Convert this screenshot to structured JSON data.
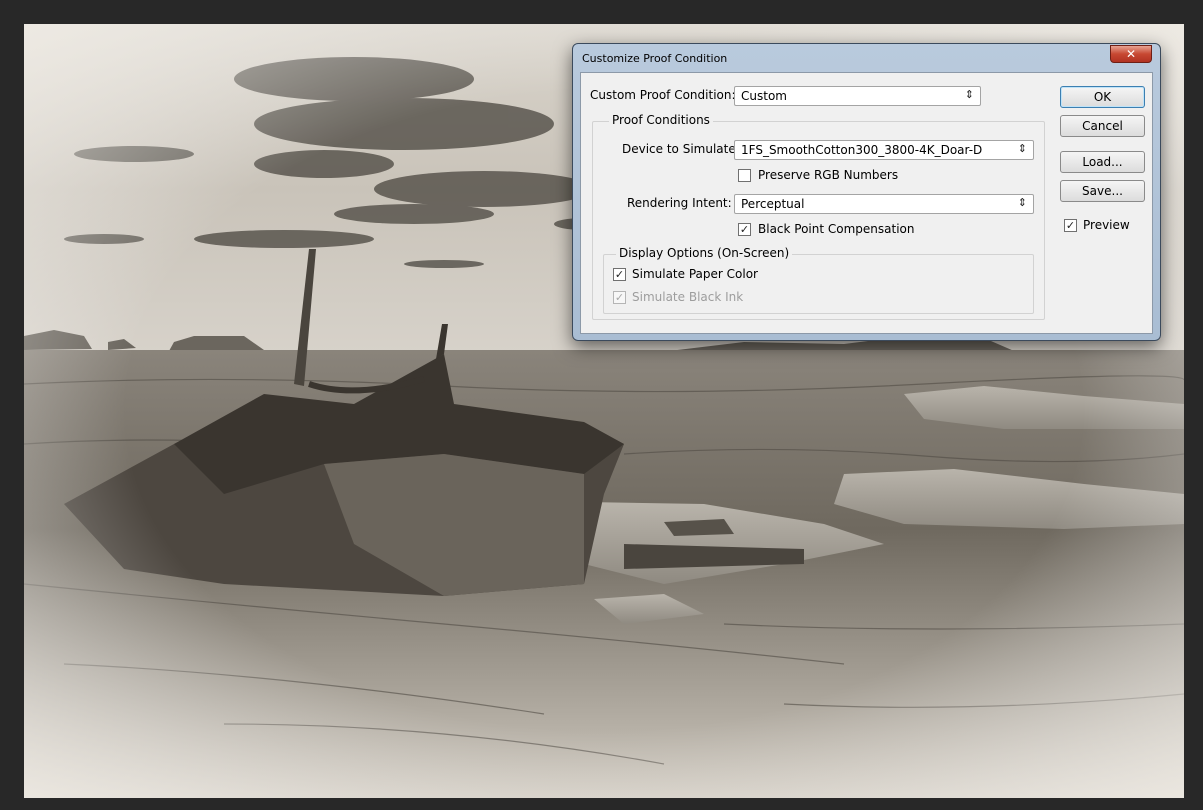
{
  "dialog": {
    "title": "Customize Proof Condition",
    "close_glyph": "✕",
    "custom_condition": {
      "label": "Custom Proof Condition:",
      "value": "Custom"
    },
    "proof_conditions": {
      "legend": "Proof Conditions",
      "device": {
        "label": "Device to Simulate:",
        "value": "1FS_SmoothCotton300_3800-4K_Doar-D"
      },
      "preserve_rgb": {
        "label": "Preserve RGB Numbers",
        "checked": false
      },
      "intent": {
        "label": "Rendering Intent:",
        "value": "Perceptual"
      },
      "black_point": {
        "label": "Black Point Compensation",
        "checked": true
      }
    },
    "display_options": {
      "legend": "Display Options (On-Screen)",
      "paper_color": {
        "label": "Simulate Paper Color",
        "checked": true
      },
      "black_ink": {
        "label": "Simulate Black Ink",
        "checked": true,
        "enabled": false
      }
    },
    "buttons": {
      "ok": "OK",
      "cancel": "Cancel",
      "load": "Load...",
      "save": "Save..."
    },
    "preview": {
      "label": "Preview",
      "checked": true
    },
    "select_arrow": "⇕",
    "check_glyph": "✓"
  },
  "colors": {
    "window_frame": "#b9cadd",
    "client_bg": "#f0f0f0",
    "close_button": "#c74832",
    "canvas_bg": "#282828"
  },
  "photo": {
    "subject": "sepia-shipwreck-photo"
  }
}
